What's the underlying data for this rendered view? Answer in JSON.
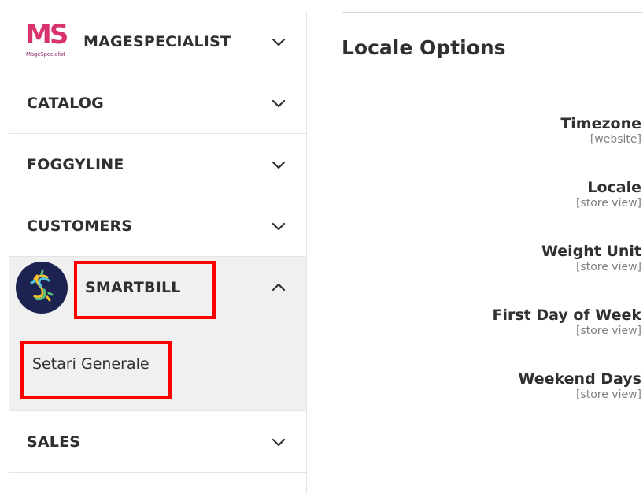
{
  "sidebar": {
    "sections": [
      {
        "label": "MAGESPECIALIST",
        "logo_text": "MS",
        "logo_subtext": "MageSpecialist",
        "chevron": "chevron-down-icon"
      },
      {
        "label": "CATALOG",
        "chevron": "chevron-down-icon"
      },
      {
        "label": "FOGGYLINE",
        "chevron": "chevron-down-icon"
      },
      {
        "label": "CUSTOMERS",
        "chevron": "chevron-down-icon"
      },
      {
        "label": "SMARTBILL",
        "chevron": "chevron-up-icon",
        "expanded": true,
        "items": [
          {
            "label": "Setari Generale"
          }
        ]
      },
      {
        "label": "SALES",
        "chevron": "chevron-down-icon"
      }
    ]
  },
  "panel": {
    "title": "Locale Options",
    "fields": [
      {
        "label": "Timezone",
        "scope": "[website]"
      },
      {
        "label": "Locale",
        "scope": "[store view]"
      },
      {
        "label": "Weight Unit",
        "scope": "[store view]"
      },
      {
        "label": "First Day of Week",
        "scope": "[store view]"
      },
      {
        "label": "Weekend Days",
        "scope": "[store view]"
      }
    ]
  },
  "colors": {
    "highlight": "#ff0000",
    "ms_brand": "#d8336f",
    "smartbill_brand": "#1c2350",
    "active_bg": "#f0f0f0"
  }
}
